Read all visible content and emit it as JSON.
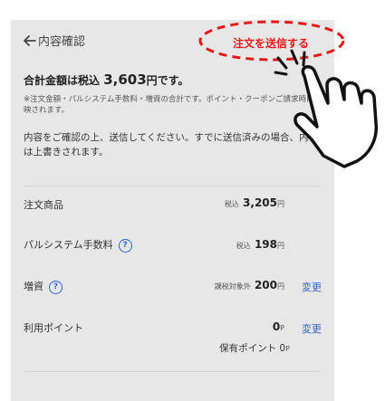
{
  "header": {
    "back_icon": "back-arrow-icon",
    "title": "内容確認",
    "submit_label": "注文を送信する",
    "highlight_color": "#e11b1b"
  },
  "summary": {
    "total_prefix": "合計金額は税込",
    "total_value": "3,603",
    "total_unit": "円",
    "total_suffix": "です。",
    "note": "※注文金額・パルシステム手数料・増資の合計です。ポイント・クーポンご請求時に反映されます。",
    "info": "内容をご確認の上、送信してください。すでに送信済みの場合、内容は上書きされます。"
  },
  "rows": {
    "order": {
      "label": "注文商品",
      "prefix": "税込",
      "value": "3,205",
      "unit": "円"
    },
    "fee": {
      "label": "パルシステム手数料",
      "prefix": "税込",
      "value": "198",
      "unit": "円"
    },
    "investment": {
      "label": "増資",
      "prefix": "課税対象外",
      "value": "200",
      "unit": "円",
      "change_label": "変更"
    },
    "points": {
      "label": "利用ポイント",
      "value": "0",
      "unit": "P",
      "change_label": "変更",
      "held_label": "保有ポイント",
      "held_value": "0",
      "held_unit": "P"
    }
  },
  "help_icon_glyph": "?",
  "accent_color": "#2f66c9"
}
